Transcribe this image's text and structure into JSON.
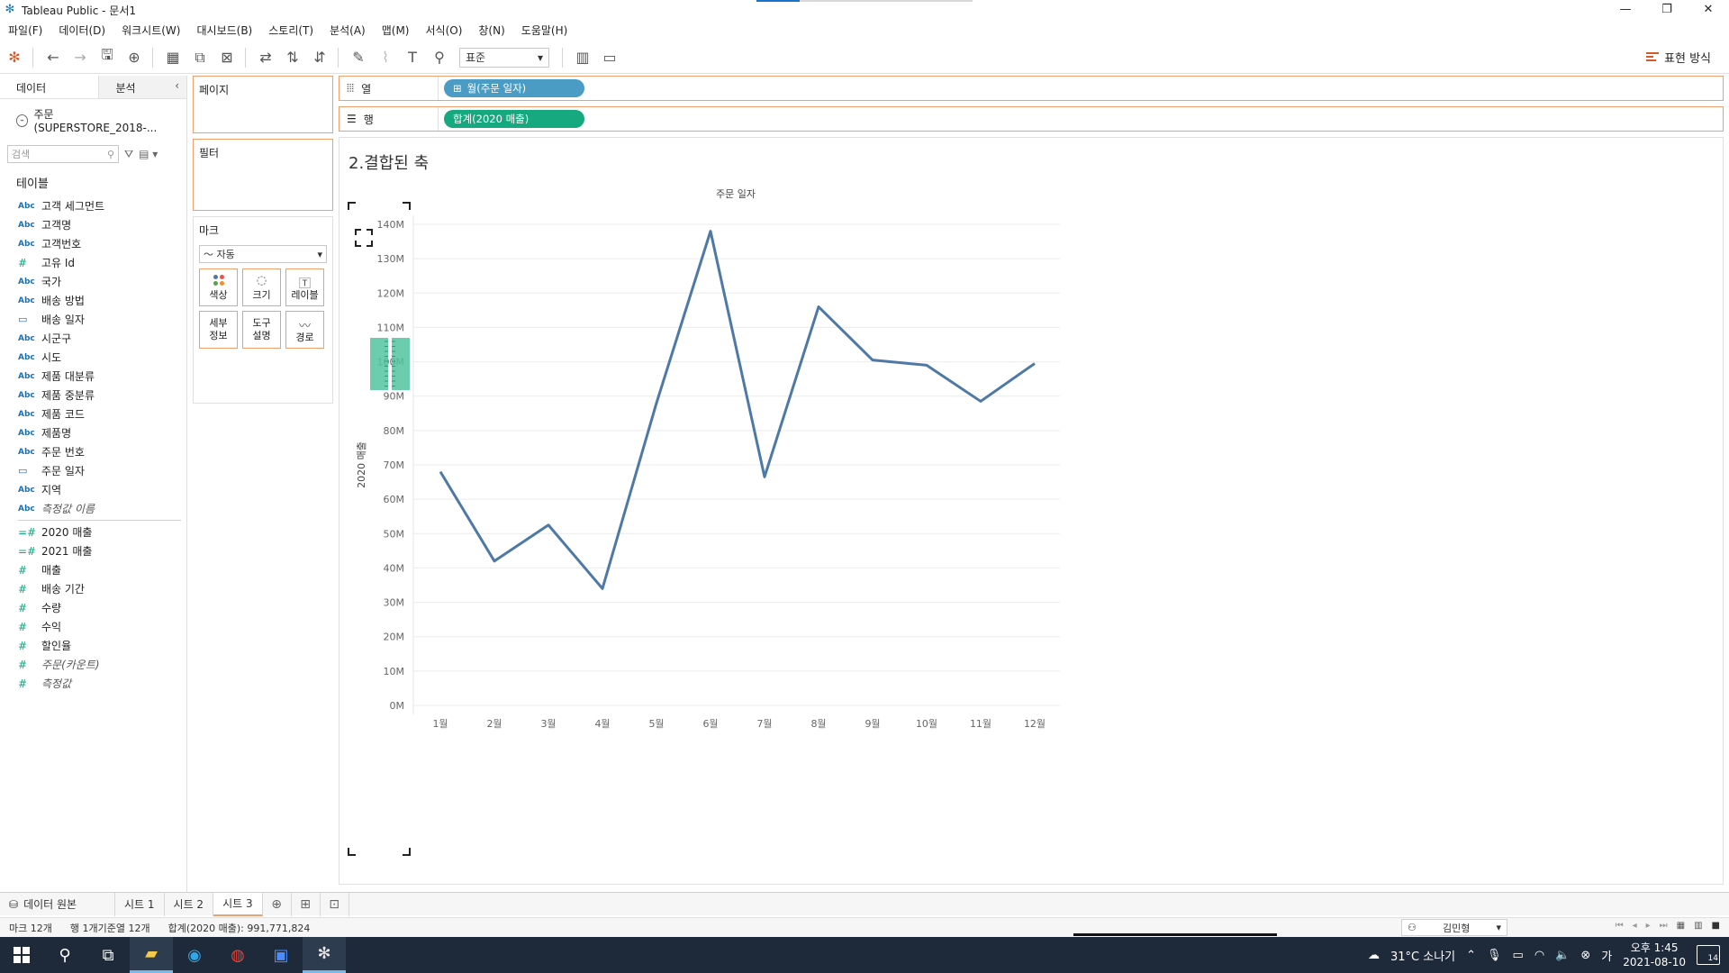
{
  "window": {
    "title": "Tableau Public - 문서1",
    "minimize": "—",
    "restore": "❐",
    "close": "✕",
    "progress": 0.2
  },
  "menu": [
    "파일(F)",
    "데이터(D)",
    "워크시트(W)",
    "대시보드(B)",
    "스토리(T)",
    "분석(A)",
    "맵(M)",
    "서식(O)",
    "창(N)",
    "도움말(H)"
  ],
  "toolbar": {
    "fit_select": "표준",
    "show_me": "표현 방식"
  },
  "datapane": {
    "tab_data": "데이터",
    "tab_analytics": "분석",
    "datasource": "주문(SUPERSTORE_2018-...",
    "search_placeholder": "검색",
    "tables_title": "테이블",
    "dimensions": [
      {
        "type": "Abc",
        "name": "고객 세그먼트"
      },
      {
        "type": "Abc",
        "name": "고객명"
      },
      {
        "type": "Abc",
        "name": "고객번호"
      },
      {
        "type": "#",
        "name": "고유 Id"
      },
      {
        "type": "Abc",
        "name": "국가"
      },
      {
        "type": "Abc",
        "name": "배송 방법"
      },
      {
        "type": "cal",
        "name": "배송 일자"
      },
      {
        "type": "Abc",
        "name": "시군구"
      },
      {
        "type": "Abc",
        "name": "시도"
      },
      {
        "type": "Abc",
        "name": "제품 대분류"
      },
      {
        "type": "Abc",
        "name": "제품 중분류"
      },
      {
        "type": "Abc",
        "name": "제품 코드"
      },
      {
        "type": "Abc",
        "name": "제품명"
      },
      {
        "type": "Abc",
        "name": "주문 번호"
      },
      {
        "type": "cal",
        "name": "주문 일자"
      },
      {
        "type": "Abc",
        "name": "지역"
      },
      {
        "type": "Abc",
        "name": "측정값 이름"
      }
    ],
    "measures": [
      {
        "type": "=#",
        "name": "2020 매출"
      },
      {
        "type": "=#",
        "name": "2021 매출"
      },
      {
        "type": "#",
        "name": "매출"
      },
      {
        "type": "#",
        "name": "배송 기간"
      },
      {
        "type": "#",
        "name": "수량"
      },
      {
        "type": "#",
        "name": "수익"
      },
      {
        "type": "#",
        "name": "할인율"
      },
      {
        "type": "#",
        "name": "주문(카운트)"
      },
      {
        "type": "#",
        "name": "측정값"
      }
    ]
  },
  "cards": {
    "pages": "페이지",
    "filters": "필터",
    "marks": "마크",
    "mark_type": "자동",
    "mark_buttons": [
      "색상",
      "크기",
      "레이블",
      "세부\n정보",
      "도구\n설명",
      "경로"
    ]
  },
  "shelves": {
    "columns_label": "열",
    "rows_label": "행",
    "columns_pill": "월(주문 일자)",
    "rows_pill": "합계(2020 매출)",
    "dim_color": "#4b9cc4",
    "meas_color": "#16a87e"
  },
  "view": {
    "sheet_title": "2.결합된 축"
  },
  "chart_data": {
    "type": "line",
    "title": "",
    "xlabel": "주문 일자",
    "ylabel": "2020 매출",
    "categories": [
      "1월",
      "2월",
      "3월",
      "4월",
      "5월",
      "6월",
      "7월",
      "8월",
      "9월",
      "10월",
      "11월",
      "12월"
    ],
    "values": [
      68,
      42,
      52.5,
      34,
      88,
      138,
      66.5,
      116,
      100.5,
      99,
      88.5,
      99.5
    ],
    "value_unit": "M",
    "yticks": [
      "0M",
      "10M",
      "20M",
      "30M",
      "40M",
      "50M",
      "60M",
      "70M",
      "80M",
      "90M",
      "100M",
      "110M",
      "120M",
      "130M",
      "140M"
    ],
    "ylim": [
      0,
      140
    ],
    "line_color": "#4e79a7",
    "grid": true
  },
  "sheetbar": {
    "datasource_tab": "데이터 원본",
    "tabs": [
      "시트 1",
      "시트 2",
      "시트 3"
    ],
    "active": 2
  },
  "status": {
    "marks": "마크 12개",
    "rows_cols": "행 1개기준열 12개",
    "sum": "합계(2020 매출): 991,771,824",
    "user": "김민형"
  },
  "taskbar": {
    "weather": "31°C 소나기",
    "ime": "가",
    "time": "오후 1:45",
    "date": "2021-08-10",
    "notifications": "14"
  }
}
